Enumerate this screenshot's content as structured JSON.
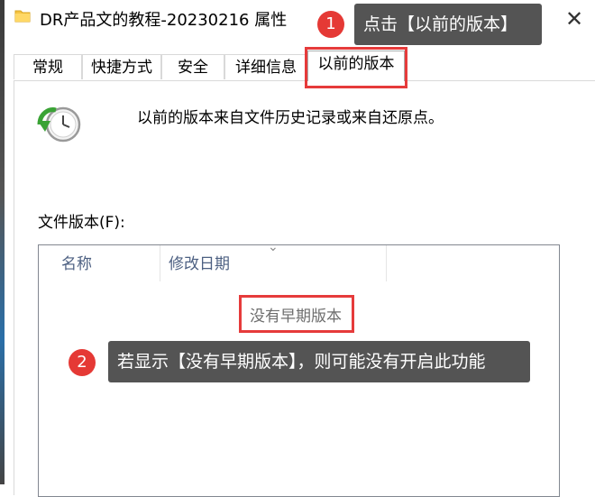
{
  "window": {
    "title": "DR产品文的教程-20230216 属性",
    "close_glyph": "✕"
  },
  "tabs": [
    {
      "label": "常规",
      "active": false
    },
    {
      "label": "快捷方式",
      "active": false
    },
    {
      "label": "安全",
      "active": false
    },
    {
      "label": "详细信息",
      "active": false
    },
    {
      "label": "以前的版本",
      "active": true
    }
  ],
  "panel": {
    "description": "以前的版本来自文件历史记录或来自还原点。",
    "versions_label": "文件版本(F):",
    "columns": [
      "名称",
      "修改日期"
    ],
    "sort_indicator": "⌄",
    "empty_message": "没有早期版本"
  },
  "annotations": {
    "step1": {
      "number": "1",
      "text": "点击【以前的版本】"
    },
    "step2": {
      "number": "2",
      "text": "若显示【没有早期版本】，则可能没有开启此功能"
    },
    "highlight_color": "#e63b3b",
    "badge_color": "#e53935",
    "callout_color": "#545454"
  },
  "icons": {
    "window_icon": "folder-icon",
    "panel_icon": "restore-clock-icon"
  }
}
